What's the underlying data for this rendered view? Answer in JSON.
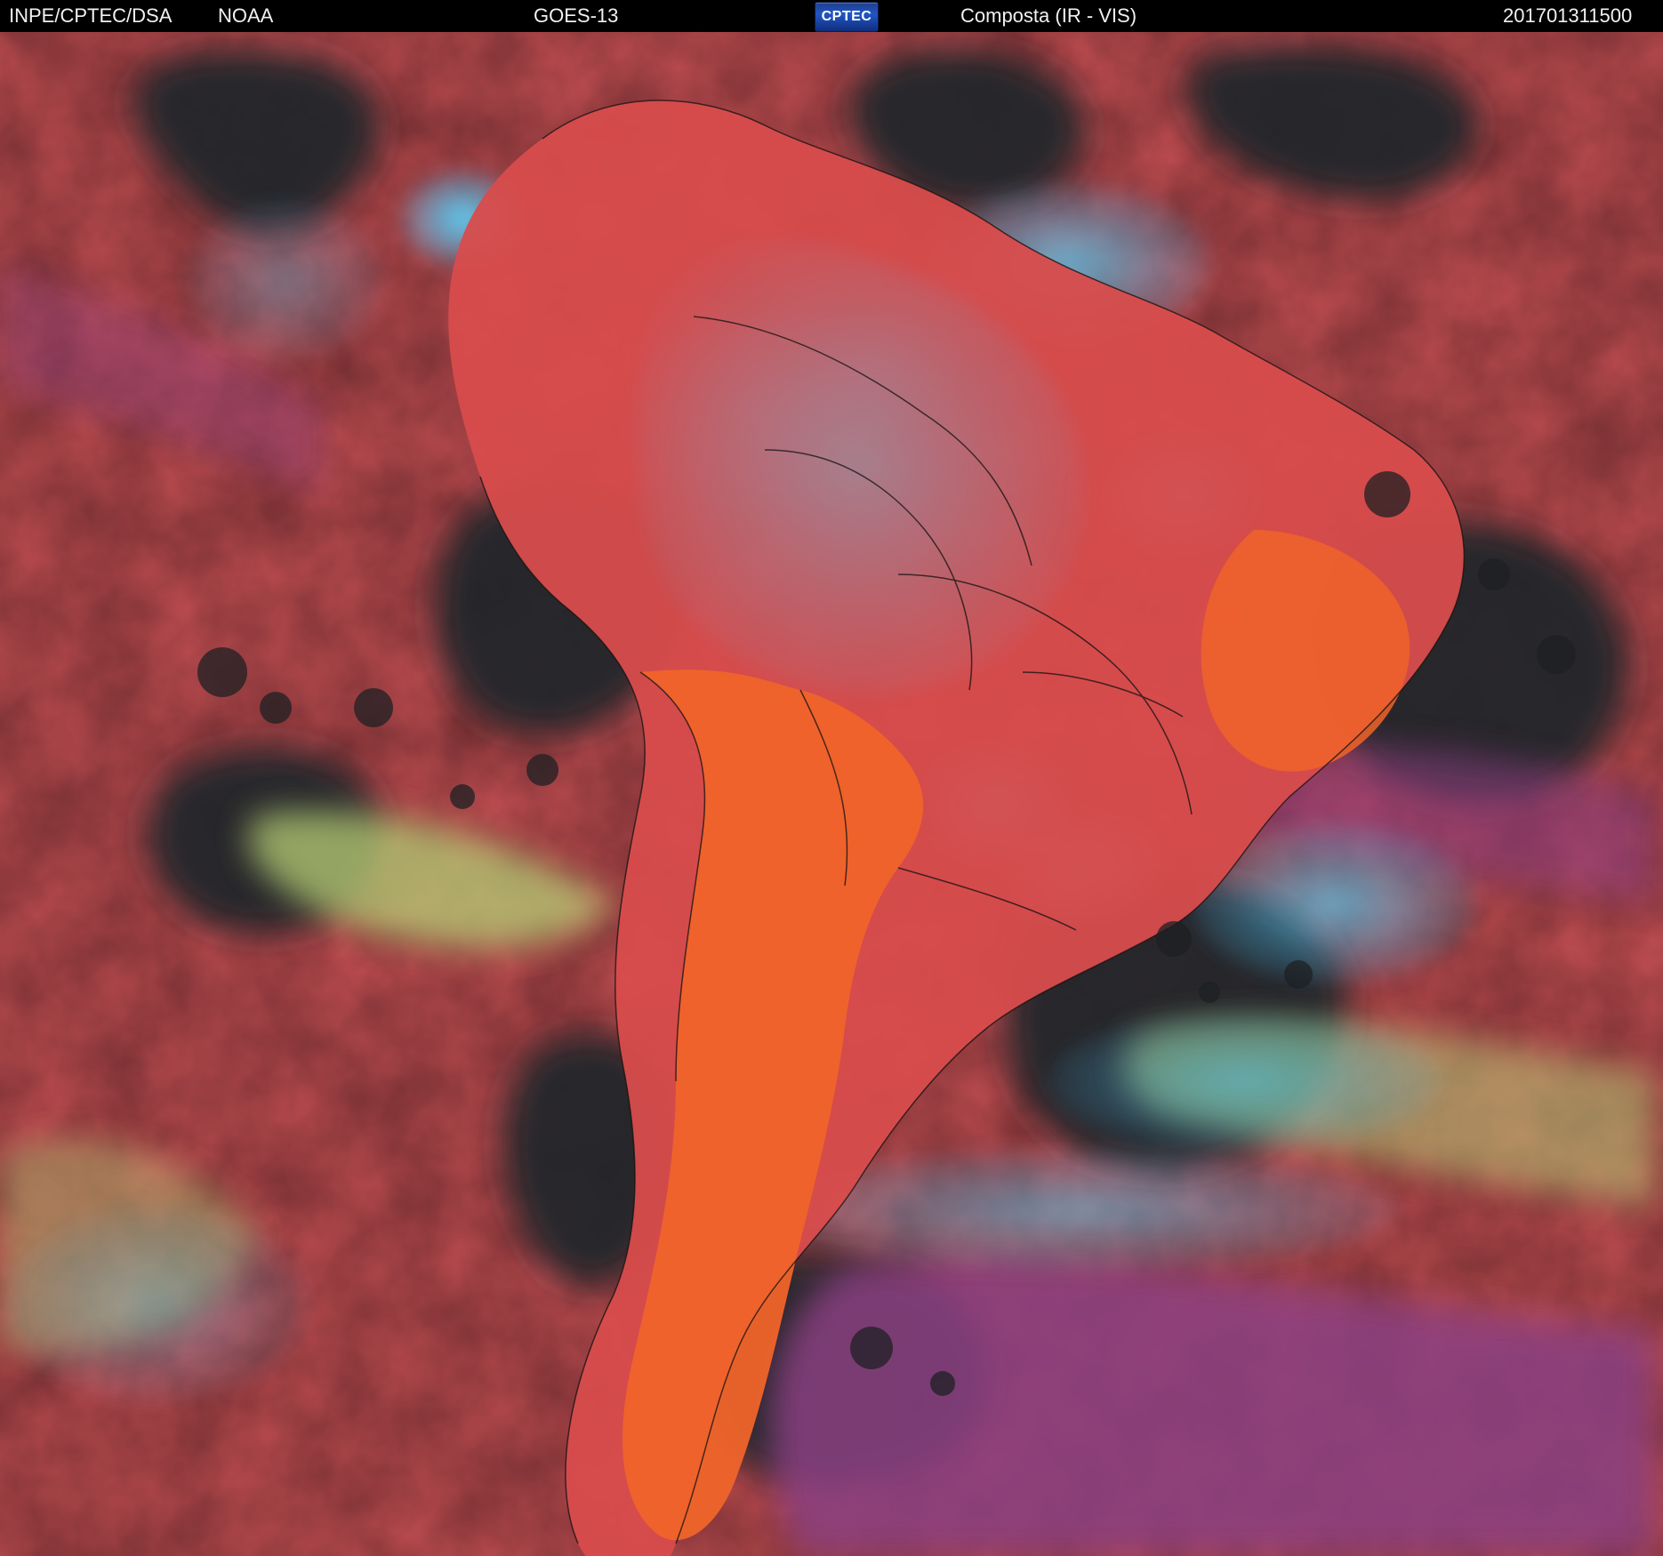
{
  "header": {
    "org": "INPE/CPTEC/DSA",
    "agency": "NOAA",
    "satellite": "GOES-13",
    "logo_text": "CPTEC",
    "product": "Composta (IR - VIS)",
    "timestamp": "201701311500"
  },
  "colors": {
    "background": "#000000",
    "ocean_clear": "#232629",
    "low_cloud_red": "#d24a4a",
    "desert_orange": "#f0642a",
    "cold_cloud_cyan": "#3fc4ff",
    "mid_cloud_green": "#b8cf76",
    "high_cloud_purple": "#8b3f82",
    "border_lines": "#111111"
  }
}
